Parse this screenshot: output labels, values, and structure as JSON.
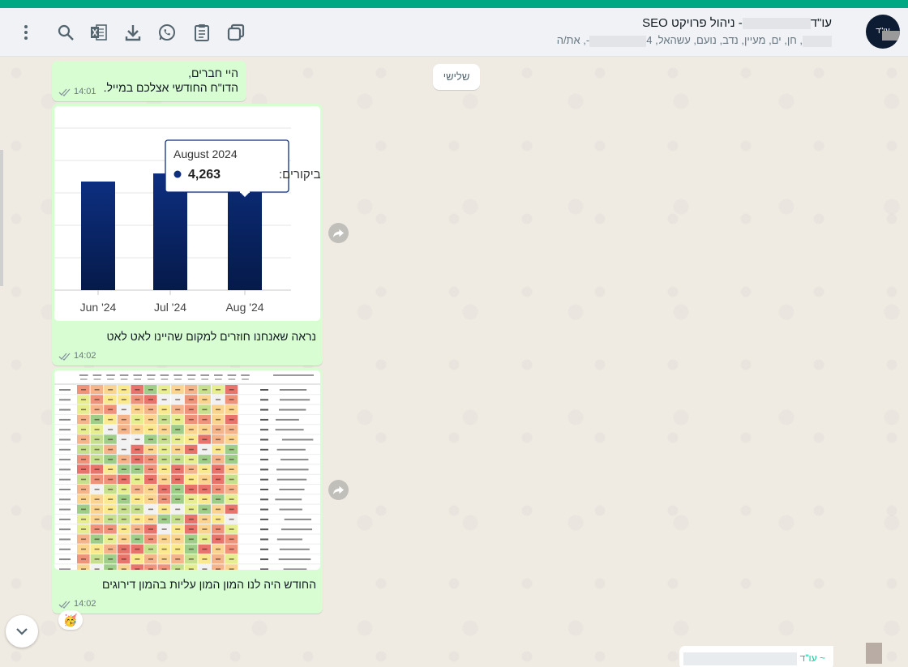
{
  "header": {
    "title": "עו\"ד              - ניהול פרויקט SEO",
    "title_prefix": "עו\"ד",
    "title_suffix": "- ניהול פרויקט SEO",
    "subtitle_names": ", חן, ים, מעיין, נדב, נועם, עשהאל, 4",
    "subtitle_end": "-, את/ה",
    "avatar_text": "עו\"ד",
    "icons": [
      "menu-icon",
      "search-icon",
      "excel-icon",
      "download-icon",
      "whatsapp-icon",
      "clipboard-icon",
      "copy-icon"
    ]
  },
  "chat": {
    "day_chip": "שלישי",
    "messages": [
      {
        "lines": [
          "היי חברים,",
          "הדו\"ח החודשי אצלכם במייל."
        ],
        "time": "14:01"
      },
      {
        "caption": "נראה שאנחנו חוזרים למקום שהיינו לאט לאט",
        "time": "14:02"
      },
      {
        "caption": "החודש היה לנו המון המון עליות בהמון דירוגים",
        "time": "14:02",
        "reaction": "🥳"
      }
    ],
    "incoming_preview": "~ עו\"ד"
  },
  "chart_data": {
    "type": "bar",
    "categories": [
      "Jun '24",
      "Jul '24",
      "Aug '24"
    ],
    "series": [
      {
        "name": "ביקורים",
        "values": [
          3350,
          3600,
          4263
        ]
      }
    ],
    "tooltip": {
      "title": "August 2024",
      "label": "ביקורים:",
      "value": "4,263"
    },
    "ylim": [
      0,
      5000
    ],
    "grid": true,
    "colors": {
      "bar_top": "#0d2f80",
      "bar_bottom": "#061a4a"
    }
  },
  "heatmap": {
    "header": [
      "שם מילת מפתח",
      "נפח חיפוש",
      "Sep 2023",
      "Oct 2023",
      "Nov 2023",
      "Dec 2023",
      "Jan 2024",
      "Feb 2024",
      "Mar 2024",
      "Apr 2024",
      "May 2024",
      "Jun 2024",
      "Jul 2024",
      "Aug 2024",
      "שינוי"
    ],
    "rows": 19
  },
  "colors": {
    "accent": "#00a884",
    "bubble_out": "#d9fdd3",
    "background": "#efeae2"
  }
}
